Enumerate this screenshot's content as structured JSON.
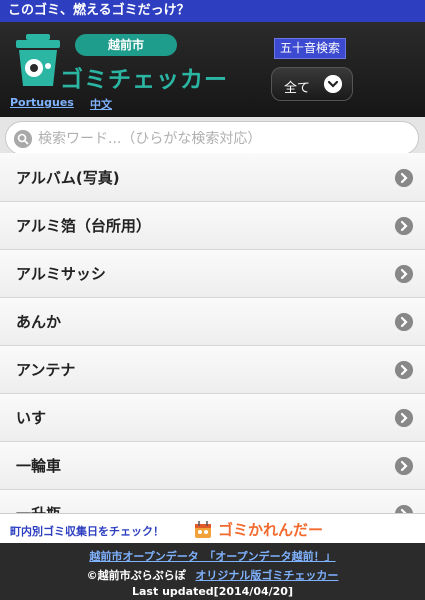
{
  "topbar": {
    "text": "このゴミ、燃えるゴミだっけ？"
  },
  "header": {
    "city": "越前市",
    "app_title": "ゴミチェッカー",
    "kana_button": "五十音検索",
    "filter_button": "全て",
    "languages": [
      "Portugues",
      "中文"
    ]
  },
  "search": {
    "placeholder": "検索ワード...（ひらがな検索対応）",
    "value": ""
  },
  "items": [
    {
      "label": "アルバム(写真)"
    },
    {
      "label": "アルミ箔（台所用）"
    },
    {
      "label": "アルミサッシ"
    },
    {
      "label": "あんか"
    },
    {
      "label": "アンテナ"
    },
    {
      "label": "いす"
    },
    {
      "label": "一輪車"
    },
    {
      "label": "一升瓶"
    }
  ],
  "banner": {
    "left_text": "町内別ゴミ収集日をチェック！",
    "app_name": "ゴミかれんだー"
  },
  "footer": {
    "link1": "越前市オープンデータ　「オープンデータ越前！」",
    "copyright": "©越前市ぷらぷらぽ",
    "link2": "オリジナル版ゴミチェッカー",
    "updated": "Last updated[2014/04/20]"
  },
  "colors": {
    "topbar": "#2d3fc0",
    "accent": "#2bb6a4",
    "banner_orange": "#f26a2d"
  }
}
